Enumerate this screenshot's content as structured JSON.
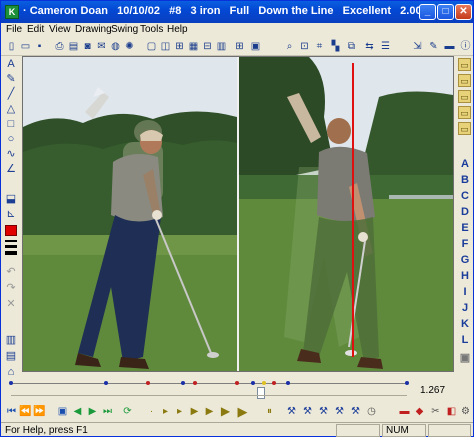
{
  "window": {
    "title": "· Cameron Doan   10/10/02   #8   3 iron   Full   Down the Line   Excellent   2.00",
    "app_icon": "K",
    "minimize": "_",
    "maximize": "□",
    "close": "✕"
  },
  "menu": [
    "File",
    "Edit",
    "View",
    "Drawing",
    "Swing",
    "Tools",
    "Help"
  ],
  "right_letters": [
    "A",
    "B",
    "C",
    "D",
    "E",
    "F",
    "G",
    "H",
    "I",
    "J",
    "K",
    "L"
  ],
  "timeline": {
    "value": "1.267",
    "markers": [
      {
        "pos": 0.0,
        "color": "#1a2fa8"
      },
      {
        "pos": 0.24,
        "color": "#1a2fa8"
      },
      {
        "pos": 0.345,
        "color": "#c02020"
      },
      {
        "pos": 0.435,
        "color": "#1a2fa8"
      },
      {
        "pos": 0.465,
        "color": "#c02020"
      },
      {
        "pos": 0.57,
        "color": "#c02020"
      },
      {
        "pos": 0.61,
        "color": "#1a2fa8"
      },
      {
        "pos": 0.64,
        "color": "#e0c020"
      },
      {
        "pos": 0.665,
        "color": "#c02020"
      },
      {
        "pos": 0.7,
        "color": "#1a2fa8"
      },
      {
        "pos": 1.0,
        "color": "#1a2fa8"
      }
    ]
  },
  "status": {
    "help": "For Help, press F1",
    "num": "NUM"
  },
  "colors": {
    "titlebar": "#0a3fbf",
    "grass": "#5f8a3c",
    "trees": "#2f5028",
    "sky": "#dfe6ec",
    "swing_line": "#e01010"
  }
}
